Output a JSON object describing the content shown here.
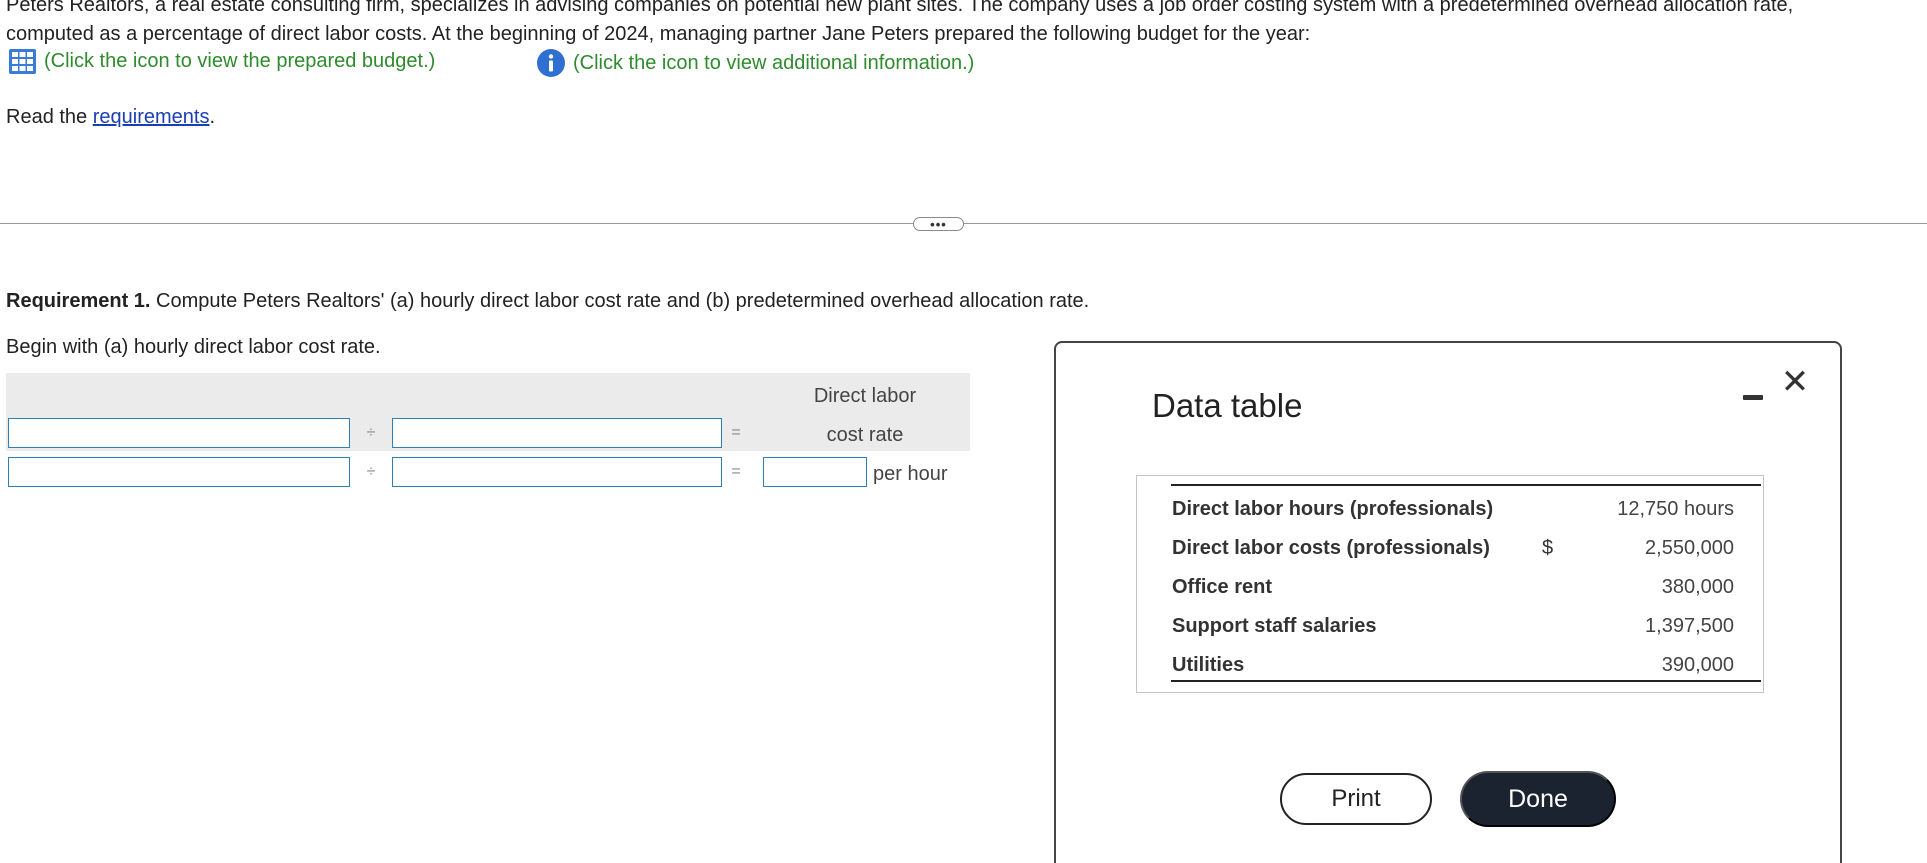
{
  "intro": {
    "line1": "Peters Realtors, a real estate consulting firm, specializes in advising companies on potential new plant sites. The company uses a job order costing system with a predetermined overhead allocation rate,",
    "line2": "computed as a percentage of direct labor costs. At the beginning of 2024, managing partner Jane Peters prepared the following budget for the year:"
  },
  "links": {
    "budget_text": "(Click the icon to view the prepared budget.)",
    "budget_icon": "table-grid-icon",
    "info_text": "(Click the icon to view additional information.)",
    "info_icon": "info-icon"
  },
  "read": {
    "prefix": "Read the ",
    "link": "requirements",
    "suffix": "."
  },
  "divider": {
    "button_label": "•••"
  },
  "requirement": {
    "label": "Requirement 1.",
    "text": " Compute Peters Realtors' (a) hourly direct labor cost rate and (b) predetermined overhead allocation rate.",
    "begin": "Begin with (a) hourly direct labor cost rate."
  },
  "calc": {
    "header_line1": "Direct labor",
    "header_line2": "cost rate",
    "divide_sign": "÷",
    "equals_sign": "=",
    "unit": "per hour",
    "row1": {
      "input1": "",
      "input2": ""
    },
    "row2": {
      "input1": "",
      "input2": "",
      "result": ""
    }
  },
  "modal": {
    "title": "Data table",
    "minimize_icon": "minimize-icon",
    "close_icon": "close-icon",
    "close_glyph": "✕",
    "rows": [
      {
        "label": "Direct labor hours (professionals)",
        "dollar": "",
        "value": "12,750 hours"
      },
      {
        "label": "Direct labor costs (professionals)",
        "dollar": "$",
        "value": "2,550,000"
      },
      {
        "label": "Office rent",
        "dollar": "",
        "value": "380,000"
      },
      {
        "label": "Support staff salaries",
        "dollar": "",
        "value": "1,397,500"
      },
      {
        "label": "Utilities",
        "dollar": "",
        "value": "390,000"
      }
    ],
    "print_label": "Print",
    "done_label": "Done"
  }
}
